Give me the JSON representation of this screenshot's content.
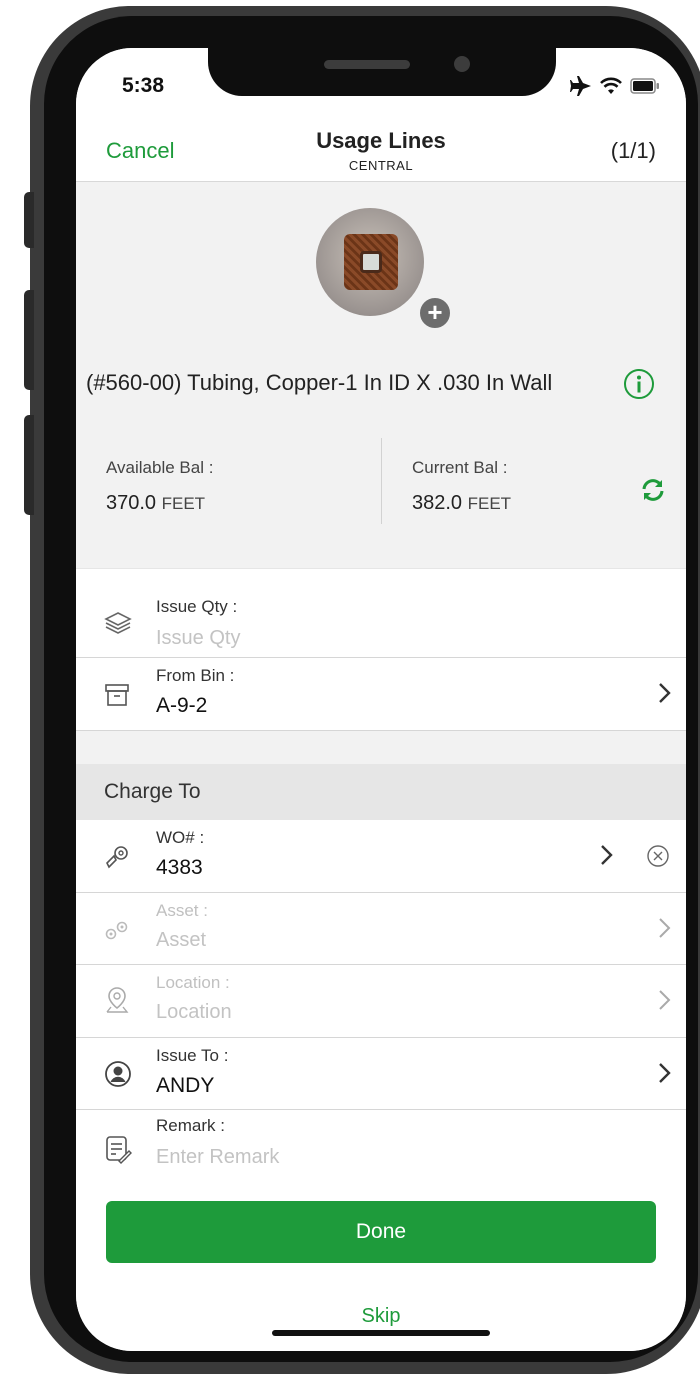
{
  "status_bar": {
    "time": "5:38"
  },
  "nav": {
    "cancel": "Cancel",
    "title": "Usage Lines",
    "subtitle": "CENTRAL",
    "count": "(1/1)"
  },
  "item": {
    "name": "(#560-00) Tubing, Copper-1 In ID X .030 In Wall",
    "available_label": "Available Bal :",
    "available_value": "370.0",
    "available_unit": "FEET",
    "current_label": "Current Bal :",
    "current_value": "382.0",
    "current_unit": "FEET"
  },
  "fields": {
    "issue_qty": {
      "label": "Issue Qty :",
      "placeholder": "Issue Qty"
    },
    "from_bin": {
      "label": "From Bin :",
      "value": "A-9-2"
    }
  },
  "charge_to": {
    "header": "Charge To",
    "wo": {
      "label": "WO# :",
      "value": "4383"
    },
    "asset": {
      "label": "Asset :",
      "placeholder": "Asset"
    },
    "location": {
      "label": "Location :",
      "placeholder": "Location"
    },
    "issue_to": {
      "label": "Issue To :",
      "value": "ANDY"
    },
    "remark": {
      "label": "Remark :",
      "placeholder": "Enter Remark"
    }
  },
  "actions": {
    "done": "Done",
    "skip": "Skip"
  },
  "colors": {
    "accent": "#1e9b3b"
  },
  "icons": [
    "airplane-icon",
    "wifi-icon",
    "battery-icon",
    "add-photo-icon",
    "info-icon",
    "refresh-icon",
    "layers-icon",
    "bin-box-icon",
    "chevron-right-icon",
    "wrench-gear-icon",
    "clear-icon",
    "gears-icon",
    "location-pin-icon",
    "user-icon",
    "note-icon"
  ]
}
